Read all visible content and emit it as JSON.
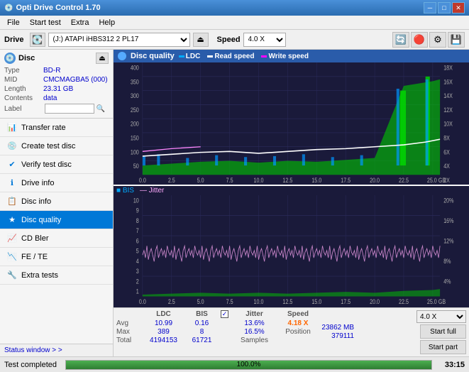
{
  "titleBar": {
    "title": "Opti Drive Control 1.70",
    "icon": "💿",
    "buttons": {
      "minimize": "─",
      "maximize": "□",
      "close": "✕"
    }
  },
  "menuBar": {
    "items": [
      "File",
      "Start test",
      "Extra",
      "Help"
    ]
  },
  "driveBar": {
    "driveLabel": "Drive",
    "driveValue": "(J:)  ATAPI iHBS312  2 PL17",
    "speedLabel": "Speed",
    "speedValue": "4.0 X"
  },
  "disc": {
    "title": "Disc",
    "type_label": "Type",
    "type_val": "BD-R",
    "mid_label": "MID",
    "mid_val": "CMCMAGBA5 (000)",
    "length_label": "Length",
    "length_val": "23.31 GB",
    "contents_label": "Contents",
    "contents_val": "data",
    "label_label": "Label"
  },
  "nav": {
    "items": [
      {
        "id": "transfer-rate",
        "label": "Transfer rate",
        "icon": "📊"
      },
      {
        "id": "create-test-disc",
        "label": "Create test disc",
        "icon": "💿"
      },
      {
        "id": "verify-test-disc",
        "label": "Verify test disc",
        "icon": "✔"
      },
      {
        "id": "drive-info",
        "label": "Drive info",
        "icon": "ℹ"
      },
      {
        "id": "disc-info",
        "label": "Disc info",
        "icon": "📋"
      },
      {
        "id": "disc-quality",
        "label": "Disc quality",
        "icon": "★",
        "active": true
      },
      {
        "id": "cd-bler",
        "label": "CD Bler",
        "icon": "📈"
      },
      {
        "id": "fe-te",
        "label": "FE / TE",
        "icon": "📉"
      },
      {
        "id": "extra-tests",
        "label": "Extra tests",
        "icon": "🔧"
      }
    ],
    "statusWindow": "Status window > >"
  },
  "chartHeader": {
    "title": "Disc quality",
    "legend": {
      "ldc": "LDC",
      "readSpeed": "Read speed",
      "writeSpeed": "Write speed"
    }
  },
  "chart1": {
    "yAxisMax": "400",
    "yAxisLabels": [
      "400",
      "350",
      "300",
      "250",
      "200",
      "150",
      "100",
      "50"
    ],
    "yAxisRight": [
      "18X",
      "16X",
      "14X",
      "12X",
      "10X",
      "8X",
      "6X",
      "4X",
      "2X"
    ],
    "xAxisLabels": [
      "0.0",
      "2.5",
      "5.0",
      "7.5",
      "10.0",
      "12.5",
      "15.0",
      "17.5",
      "20.0",
      "22.5",
      "25.0 GB"
    ]
  },
  "chart2": {
    "title": "BIS",
    "title2": "Jitter",
    "yAxisLabels": [
      "10",
      "9",
      "8",
      "7",
      "6",
      "5",
      "4",
      "3",
      "2",
      "1"
    ],
    "yAxisRight": [
      "20%",
      "16%",
      "12%",
      "8%",
      "4%"
    ],
    "xAxisLabels": [
      "0.0",
      "2.5",
      "5.0",
      "7.5",
      "10.0",
      "12.5",
      "15.0",
      "17.5",
      "20.0",
      "22.5",
      "25.0 GB"
    ]
  },
  "statsBar": {
    "headers": [
      "",
      "LDC",
      "BIS",
      "",
      "Jitter",
      "Speed",
      ""
    ],
    "avg_label": "Avg",
    "avg_ldc": "10.99",
    "avg_bis": "0.16",
    "avg_jitter": "13.6%",
    "max_label": "Max",
    "max_ldc": "389",
    "max_bis": "8",
    "max_jitter": "16.5%",
    "total_label": "Total",
    "total_ldc": "4194153",
    "total_bis": "61721",
    "speed_label": "Speed",
    "speed_val": "4.18 X",
    "speed_dropdown": "4.0 X",
    "position_label": "Position",
    "position_val": "23862 MB",
    "samples_label": "Samples",
    "samples_val": "379111",
    "jitter_checked": "✓"
  },
  "startButtons": {
    "startFull": "Start full",
    "startPart": "Start part"
  },
  "bottomBar": {
    "status": "Test completed",
    "progress": "100.0%",
    "progressPct": 100,
    "time": "33:15"
  }
}
